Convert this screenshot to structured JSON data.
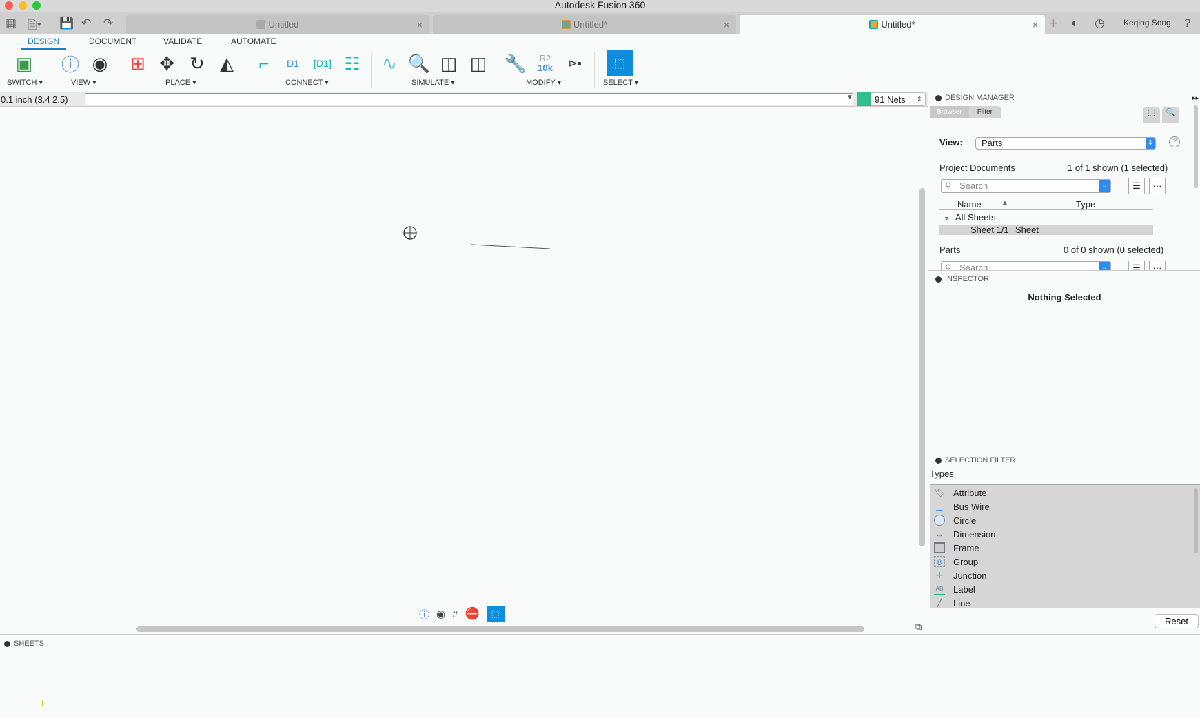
{
  "window": {
    "title": "Autodesk Fusion 360"
  },
  "tabs": [
    {
      "label": "Untitled"
    },
    {
      "label": "Untitled*"
    },
    {
      "label": "Untitled*"
    }
  ],
  "user": {
    "name": "Keqing Song"
  },
  "ribbon": {
    "tabs": [
      "DESIGN",
      "DOCUMENT",
      "VALIDATE",
      "AUTOMATE"
    ],
    "groups": [
      "SWITCH",
      "VIEW",
      "PLACE",
      "CONNECT",
      "SIMULATE",
      "MODIFY",
      "SELECT"
    ],
    "modify_text": {
      "r2": "R2",
      "val": "10k"
    }
  },
  "command": {
    "coords": "0.1 inch (3.4 2.5)",
    "input": "",
    "nets": "91 Nets"
  },
  "design_manager": {
    "title": "DESIGN MANAGER",
    "tabs": [
      "Browser",
      "Filter"
    ],
    "view_label": "View:",
    "view_value": "Parts",
    "project_docs": {
      "label": "Project Documents",
      "count": "1 of 1 shown (1 selected)",
      "search_placeholder": "Search"
    },
    "columns": [
      "Name",
      "Type"
    ],
    "tree": {
      "group": "All Sheets",
      "rows": [
        {
          "name": "Sheet 1/1",
          "type": "Sheet"
        }
      ]
    },
    "parts": {
      "label": "Parts",
      "count": "0 of 0 shown (0 selected)",
      "search_placeholder": "Search"
    }
  },
  "inspector": {
    "title": "INSPECTOR",
    "message": "Nothing Selected"
  },
  "selection_filter": {
    "title": "SELECTION FILTER",
    "types_label": "Types",
    "types": [
      "Attribute",
      "Bus Wire",
      "Circle",
      "Dimension",
      "Frame",
      "Group",
      "Junction",
      "Label",
      "Line"
    ],
    "reset": "Reset"
  },
  "sheets": {
    "title": "SHEETS",
    "items": [
      "1"
    ]
  },
  "colors": {
    "accent": "#1a7fc6",
    "select": "#0d8ddb",
    "nets": "#2fbf8c"
  }
}
